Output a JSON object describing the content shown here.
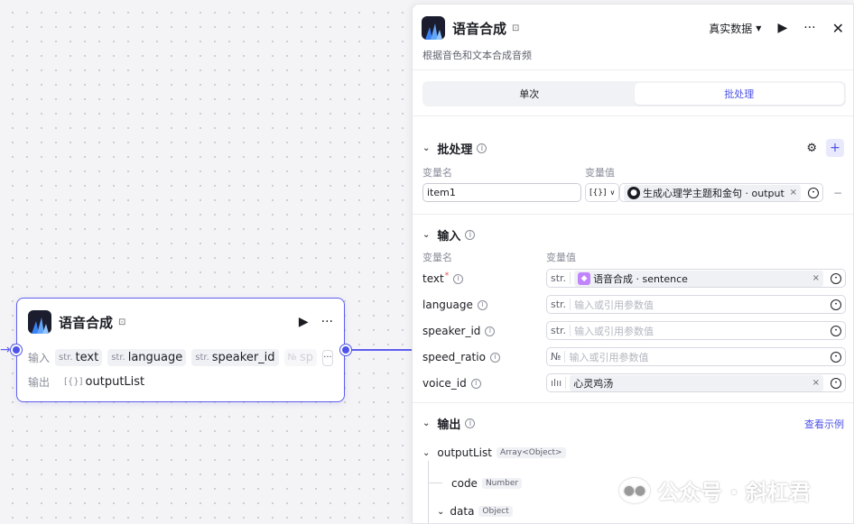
{
  "node": {
    "title": "语音合成",
    "input_label": "输入",
    "output_label": "输出",
    "inputs": [
      {
        "type": "str.",
        "name": "text"
      },
      {
        "type": "str.",
        "name": "language"
      },
      {
        "type": "str.",
        "name": "speaker_id"
      },
      {
        "type": "№",
        "name": "sp"
      }
    ],
    "more": "···",
    "outputs": [
      {
        "type": "[{}]",
        "name": "outputList"
      }
    ]
  },
  "panel": {
    "title": "语音合成",
    "data_mode": "真实数据",
    "description": "根据音色和文本合成音频",
    "tabs": [
      "单次",
      "批处理"
    ],
    "active_tab": "批处理",
    "batch": {
      "title": "批处理",
      "col_name": "变量名",
      "col_value": "变量值",
      "item_name": "item1",
      "item_type": "[{}]",
      "item_ref": "生成心理学主题和金句 · output"
    },
    "input": {
      "title": "输入",
      "col_name": "变量名",
      "col_value": "变量值",
      "rows": [
        {
          "name": "text",
          "required": "*",
          "type": "str.",
          "ref": "语音合成 · sentence",
          "placeholder": ""
        },
        {
          "name": "language",
          "required": "",
          "type": "str.",
          "ref": "",
          "placeholder": "输入或引用参数值"
        },
        {
          "name": "speaker_id",
          "required": "",
          "type": "str.",
          "ref": "",
          "placeholder": "输入或引用参数值"
        },
        {
          "name": "speed_ratio",
          "required": "",
          "type": "№",
          "ref": "",
          "placeholder": "输入或引用参数值"
        },
        {
          "name": "voice_id",
          "required": "",
          "type": "ılıı",
          "ref": "心灵鸡汤",
          "placeholder": ""
        }
      ]
    },
    "output": {
      "title": "输出",
      "view_example": "查看示例",
      "tree": [
        {
          "name": "outputList",
          "type": "Array<Object>"
        },
        {
          "name": "code",
          "type": "Number"
        },
        {
          "name": "data",
          "type": "Object"
        }
      ]
    }
  },
  "watermark": "公众号 · 斜杠君",
  "colors": {
    "accent": "#4d53e8",
    "node_border": "#5e5ff0"
  }
}
